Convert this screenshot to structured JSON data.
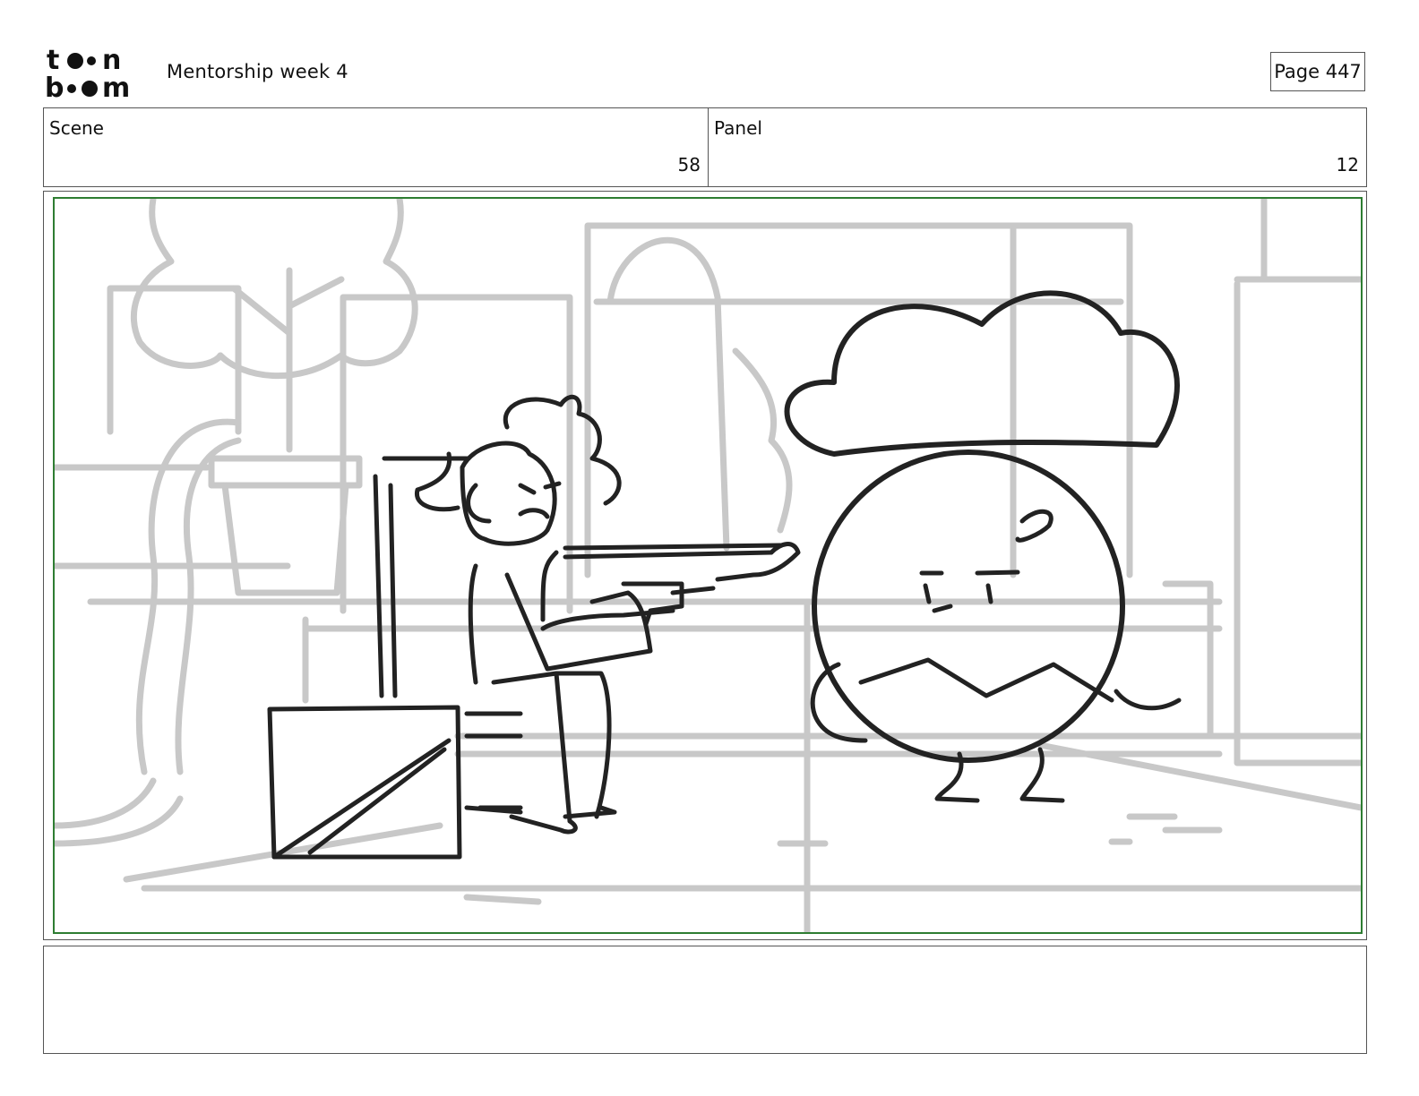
{
  "header": {
    "logo_text": "toon boom",
    "project_title": "Mentorship week 4",
    "page_label": "Page 447"
  },
  "scene": {
    "label": "Scene",
    "value": "58"
  },
  "panel": {
    "label": "Panel",
    "value": "12"
  },
  "frame_border_color": "#2e7d32",
  "notes": {
    "text": ""
  }
}
